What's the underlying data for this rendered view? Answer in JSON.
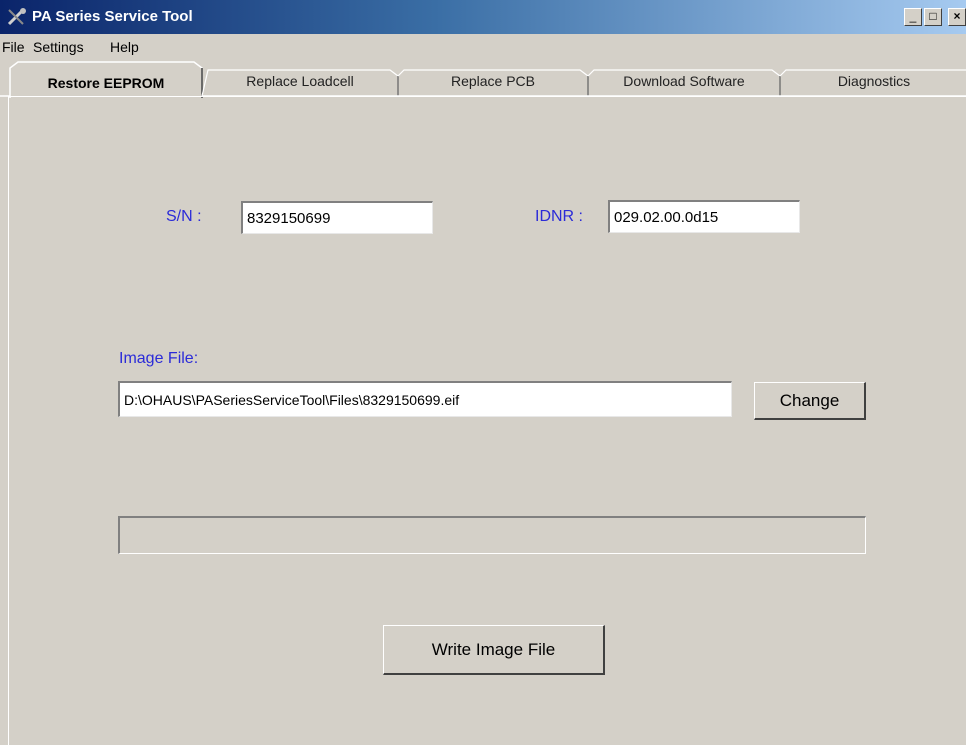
{
  "window": {
    "title": "PA Series Service Tool",
    "controls": {
      "minimize": "_",
      "maximize": "□",
      "close": "×"
    }
  },
  "menu": {
    "items": [
      "File",
      "Settings",
      "Help"
    ]
  },
  "tabs": [
    {
      "label": "Restore EEPROM",
      "active": true
    },
    {
      "label": "Replace Loadcell",
      "active": false
    },
    {
      "label": "Replace PCB",
      "active": false
    },
    {
      "label": "Download Software",
      "active": false
    },
    {
      "label": "Diagnostics",
      "active": false
    }
  ],
  "form": {
    "sn_label": "S/N :",
    "sn_value": "8329150699",
    "idnr_label": "IDNR :",
    "idnr_value": "029.02.00.0d15",
    "image_file_label": "Image File:",
    "image_file_path": "D:\\OHAUS\\PASeriesServiceTool\\Files\\8329150699.eif",
    "change_button": "Change",
    "write_button": "Write Image File"
  },
  "progress": {
    "value_percent": 0
  },
  "colors": {
    "label_blue": "#2b2bd8",
    "titlebar": "#0a246a"
  },
  "icons": {
    "app": "tools-icon"
  }
}
